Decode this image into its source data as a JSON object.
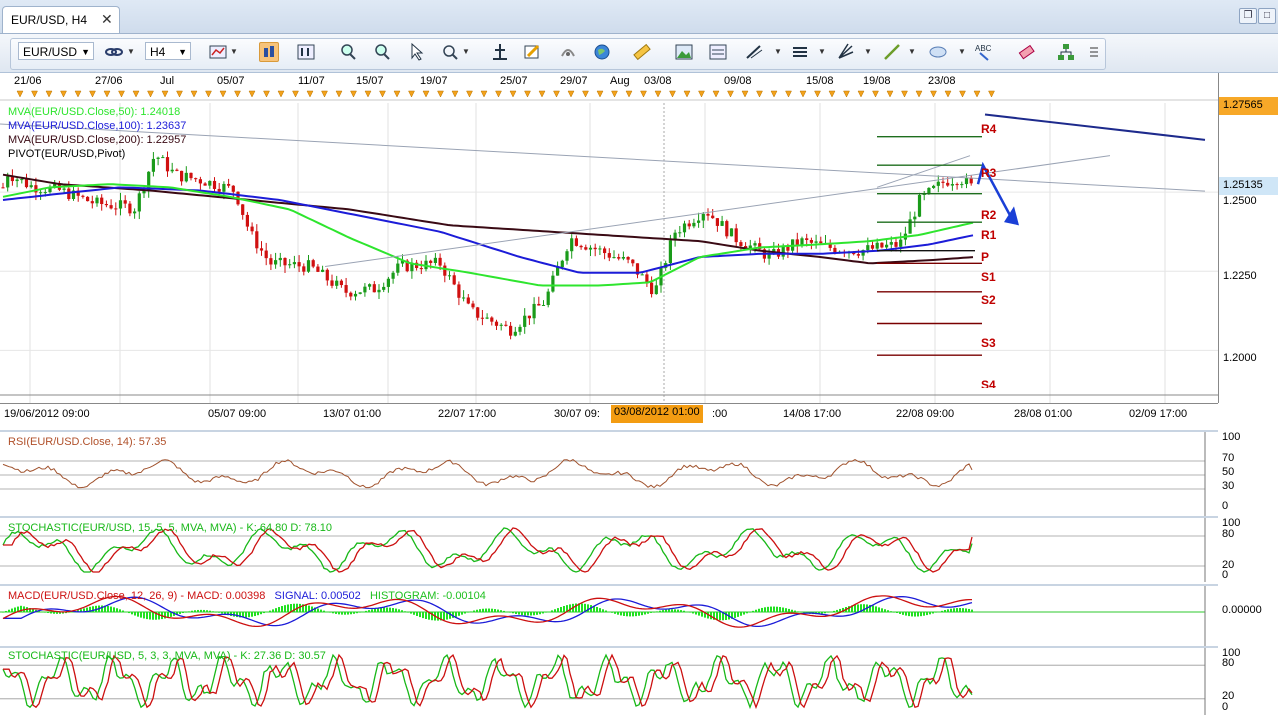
{
  "window": {
    "tab_title": "EUR/USD, H4"
  },
  "toolbar": {
    "symbol": "EUR/USD",
    "timeframe": "H4"
  },
  "colors": {
    "bull": "#1a9b1a",
    "bear": "#d01010",
    "ma50": "#2ee52e",
    "ma100": "#1c1cd8",
    "ma200": "#3a0a14",
    "pivot_line": "#1e6e1e",
    "pivot_r": "#c00000",
    "arrow": "#1a3fd6",
    "rsi": "#a0522d",
    "stoch_k": "#18b818",
    "stoch_d": "#cc1010",
    "macd": "#cc1010",
    "signal": "#1c1cd8",
    "hist": "#20e020",
    "highlight": "#f39c12"
  },
  "top_dates": [
    "21/06",
    "27/06",
    "Jul",
    "05/07",
    "11/07",
    "15/07",
    "19/07",
    "25/07",
    "29/07",
    "Aug",
    "03/08",
    "09/08",
    "15/08",
    "19/08",
    "23/08"
  ],
  "bottom_dates": [
    "19/06/2012 09:00",
    "05/07 09:00",
    "13/07 01:00",
    "22/07 17:00",
    "30/07 09:",
    ":00",
    "14/08 17:00",
    "22/08 09:00",
    "28/08 01:00",
    "02/09 17:00"
  ],
  "time_highlight": "03/08/2012 01:00",
  "price_panel": {
    "legend": [
      "MVA(EUR/USD.Close,50): 1.24018",
      "MVA(EUR/USD.Close,100): 1.23637",
      "MVA(EUR/USD.Close,200): 1.22957",
      "PIVOT(EUR/USD,Pivot)"
    ],
    "axis_labels": [
      "1.2500",
      "1.2250",
      "1.2000"
    ],
    "high_tag": "1.27565",
    "price_tag": "1.25135",
    "pivot_labels": [
      "R4",
      "R3",
      "R2",
      "R1",
      "P",
      "S1",
      "S2",
      "S3",
      "S4"
    ]
  },
  "rsi_panel": {
    "legend": "RSI(EUR/USD.Close, 14): 57.35",
    "axis": [
      "100",
      "70",
      "50",
      "30",
      "0"
    ]
  },
  "stoch1_panel": {
    "legend": "STOCHASTIC(EUR/USD, 15, 5, 5, MVA, MVA) -  K: 64.80   D: 78.10",
    "axis": [
      "100",
      "80",
      "20",
      "0"
    ]
  },
  "macd_panel": {
    "legend_macd": "MACD(EUR/USD.Close, 12, 26, 9) -  MACD: 0.00398",
    "legend_signal": "SIGNAL: 0.00502",
    "legend_hist": "HISTOGRAM: -0.00104",
    "axis": [
      "0.00000"
    ]
  },
  "stoch2_panel": {
    "legend": "STOCHASTIC(EUR/USD, 5, 3, 3, MVA, MVA) -  K: 27.36   D: 30.57",
    "axis": [
      "100",
      "80",
      "20",
      "0"
    ]
  },
  "chart_data": {
    "type": "line",
    "title": "EUR/USD, H4",
    "ylim": [
      1.1875,
      1.2775
    ],
    "series": [
      {
        "name": "MVA(EUR/USD.Close,50)",
        "last": 1.24018
      },
      {
        "name": "MVA(EUR/USD.Close,100)",
        "last": 1.23637
      },
      {
        "name": "MVA(EUR/USD.Close,200)",
        "last": 1.22957
      }
    ],
    "pivot_levels": {
      "R4": 1.2675,
      "R3": 1.2585,
      "R2": 1.2495,
      "R1": 1.2405,
      "P": 1.2315,
      "S1": 1.2275,
      "S2": 1.2185,
      "S3": 1.2085,
      "S4": 1.1985
    },
    "last_close": 1.25135,
    "indicators": {
      "RSI_14": 57.35,
      "Stoch15_K": 64.8,
      "Stoch15_D": 78.1,
      "MACD": 0.00398,
      "Signal": 0.00502,
      "Histogram": -0.00104,
      "Stoch5_K": 27.36,
      "Stoch5_D": 30.57
    }
  }
}
